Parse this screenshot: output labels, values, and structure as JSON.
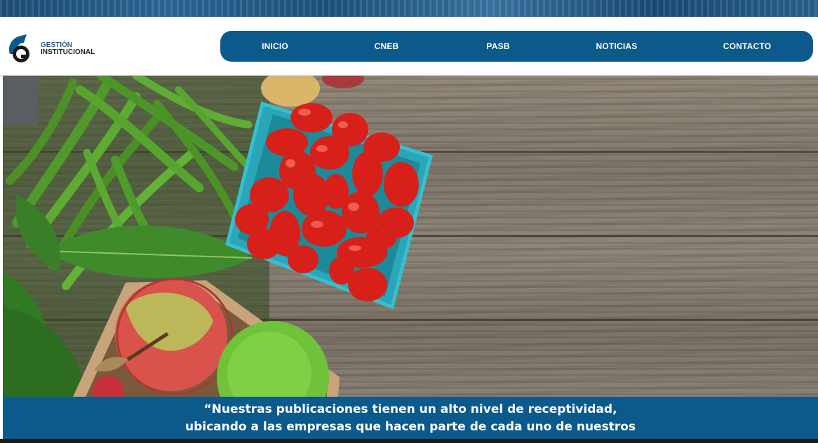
{
  "brand": {
    "line1": "GESTIÓN",
    "line2": "INSTITUCIONAL",
    "colors": {
      "primary": "#0c5a8c",
      "mark_dark": "#1a1a1a"
    }
  },
  "nav": {
    "items": [
      {
        "label": "INICIO"
      },
      {
        "label": "CNEB"
      },
      {
        "label": "PASB"
      },
      {
        "label": "NOTICIAS"
      },
      {
        "label": "CONTACTO"
      }
    ]
  },
  "hero": {
    "image": "fresh-vegetables-on-wood"
  },
  "caption": {
    "line1": "“Nuestras publicaciones tienen un alto nivel de receptividad,",
    "line2": "ubicando a las empresas que hacen parte de cada uno de nuestros"
  }
}
